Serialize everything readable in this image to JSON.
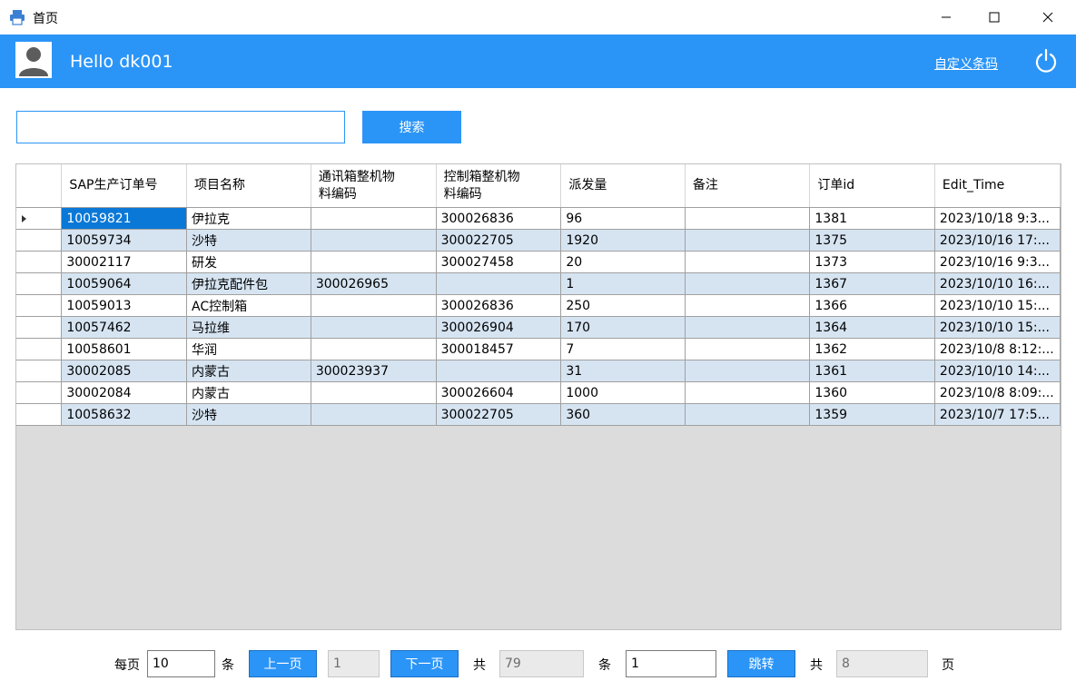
{
  "window": {
    "title": "首页",
    "minimize_glyph": "—",
    "maximize_glyph": "☐",
    "close_glyph": "✕"
  },
  "header": {
    "greeting": "Hello dk001",
    "custom_barcode_link": "自定义条码"
  },
  "search": {
    "value": "",
    "button_label": "搜索"
  },
  "table": {
    "columns": [
      "SAP生产订单号",
      "项目名称",
      "通讯箱整机物料编码",
      "控制箱整机物料编码",
      "派发量",
      "备注",
      "订单id",
      "Edit_Time"
    ],
    "column_lines": [
      [
        "SAP生产订单号"
      ],
      [
        "项目名称"
      ],
      [
        "通讯箱整机物",
        "料编码"
      ],
      [
        "控制箱整机物",
        "料编码"
      ],
      [
        "派发量"
      ],
      [
        "备注"
      ],
      [
        "订单id"
      ],
      [
        "Edit_Time"
      ]
    ],
    "rows": [
      [
        "10059821",
        "伊拉克",
        "",
        "300026836",
        "96",
        "",
        "1381",
        "2023/10/18 9:3..."
      ],
      [
        "10059734",
        "沙特",
        "",
        "300022705",
        "1920",
        "",
        "1375",
        "2023/10/16 17:..."
      ],
      [
        "30002117",
        "研发",
        "",
        "300027458",
        "20",
        "",
        "1373",
        "2023/10/16 9:3..."
      ],
      [
        "10059064",
        "伊拉克配件包",
        "300026965",
        "",
        "1",
        "",
        "1367",
        "2023/10/10 16:..."
      ],
      [
        "10059013",
        "AC控制箱",
        "",
        "300026836",
        "250",
        "",
        "1366",
        "2023/10/10 15:..."
      ],
      [
        "10057462",
        "马拉维",
        "",
        "300026904",
        "170",
        "",
        "1364",
        "2023/10/10 15:..."
      ],
      [
        "10058601",
        "华润",
        "",
        "300018457",
        "7",
        "",
        "1362",
        "2023/10/8 8:12:..."
      ],
      [
        "30002085",
        "内蒙古",
        "300023937",
        "",
        "31",
        "",
        "1361",
        "2023/10/10 14:..."
      ],
      [
        "30002084",
        "内蒙古",
        "",
        "300026604",
        "1000",
        "",
        "1360",
        "2023/10/8 8:09:..."
      ],
      [
        "10058632",
        "沙特",
        "",
        "300022705",
        "360",
        "",
        "1359",
        "2023/10/7 17:5..."
      ]
    ],
    "selected_row": 0
  },
  "pager": {
    "per_page_label": "每页",
    "per_page_value": "10",
    "unit_label": "条",
    "prev_label": "上一页",
    "current_page": "1",
    "next_label": "下一页",
    "total_label": "共",
    "total_records": "79",
    "records_unit": "条",
    "jump_value": "1",
    "jump_label": "跳转",
    "total_pages_label": "共",
    "total_pages": "8",
    "pages_unit": "页"
  },
  "colors": {
    "accent": "#2b95f7",
    "row_alt": "#d6e4f2",
    "selected_cell": "#0a78d7",
    "grid_empty": "#dcdcdc"
  },
  "icons": {
    "app": "printer-icon",
    "avatar": "user-avatar-icon",
    "power": "power-icon"
  }
}
